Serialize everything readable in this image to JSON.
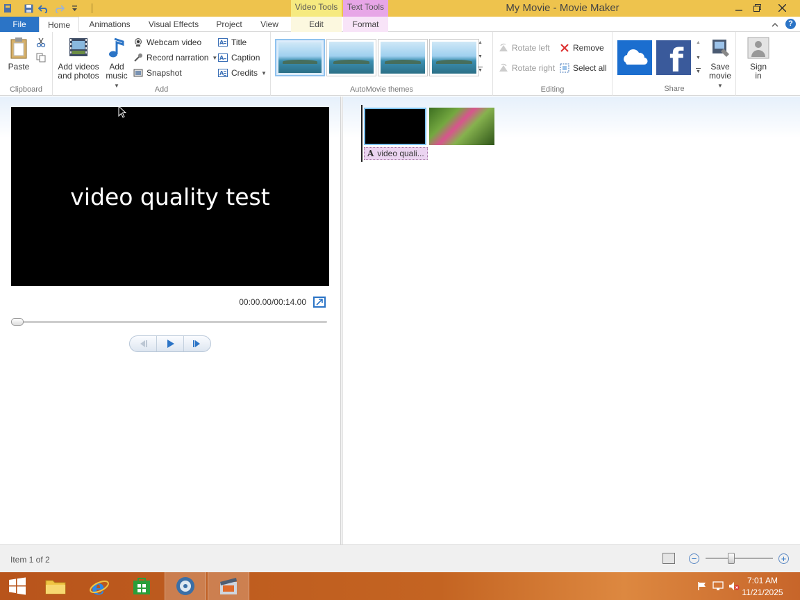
{
  "window": {
    "title": "My Movie - Movie Maker",
    "contextual_tabs": {
      "video_tools": "Video Tools",
      "text_tools": "Text Tools"
    }
  },
  "tabs": {
    "file": "File",
    "home": "Home",
    "animations": "Animations",
    "visual_effects": "Visual Effects",
    "project": "Project",
    "view": "View",
    "edit": "Edit",
    "format": "Format"
  },
  "ribbon": {
    "clipboard": {
      "label": "Clipboard",
      "paste": "Paste"
    },
    "add": {
      "label": "Add",
      "add_videos": [
        "Add videos",
        "and photos"
      ],
      "add_music": [
        "Add",
        "music"
      ],
      "webcam_video": "Webcam video",
      "record_narration": "Record narration",
      "snapshot": "Snapshot",
      "title": "Title",
      "caption": "Caption",
      "credits": "Credits"
    },
    "themes": {
      "label": "AutoMovie themes",
      "count": 4,
      "selected_index": 0
    },
    "editing": {
      "label": "Editing",
      "rotate_left": "Rotate left",
      "rotate_right": "Rotate right",
      "remove": "Remove",
      "select_all": "Select all"
    },
    "share": {
      "label": "Share",
      "save_movie": [
        "Save",
        "movie"
      ],
      "sign_in": [
        "Sign",
        "in"
      ]
    }
  },
  "preview": {
    "text": "video quality test",
    "timecode": "00:00.00/00:14.00",
    "progress": 0
  },
  "storyboard": {
    "caption_chip": "video quali..."
  },
  "status": {
    "text": "Item 1 of 2",
    "zoom_level": 0.38
  },
  "taskbar": {
    "time": "7:01 AM",
    "date": "11/21/2025"
  },
  "colors": {
    "title_bar": "#eec34d",
    "file_tab": "#2b74c6",
    "video_tools": "#f6ea80",
    "text_tools": "#e7a6e7",
    "taskbar": "#c46422"
  }
}
